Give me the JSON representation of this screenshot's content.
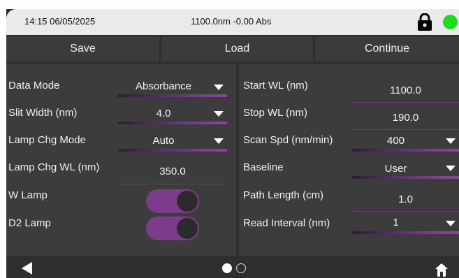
{
  "status": {
    "time": "14:15 06/05/2025",
    "reading": "1100.0nm -0.00 Abs",
    "lock_icon": "lock-icon",
    "indicator_color": "#19e019"
  },
  "toolbar": {
    "save": "Save",
    "load": "Load",
    "continue": "Continue"
  },
  "left": {
    "data_mode": {
      "label": "Data Mode",
      "value": "Absorbance"
    },
    "slit_width": {
      "label": "Slit Width (nm)",
      "value": "4.0"
    },
    "lamp_chg_mode": {
      "label": "Lamp Chg Mode",
      "value": "Auto"
    },
    "lamp_chg_wl": {
      "label": "Lamp Chg WL (nm)",
      "value": "350.0"
    },
    "w_lamp": {
      "label": "W Lamp",
      "state": "on"
    },
    "d2_lamp": {
      "label": "D2 Lamp",
      "state": "on"
    }
  },
  "right": {
    "start_wl": {
      "label": "Start WL (nm)",
      "value": "1100.0"
    },
    "stop_wl": {
      "label": "Stop WL (nm)",
      "value": "190.0"
    },
    "scan_spd": {
      "label": "Scan Spd (nm/min)",
      "value": "400"
    },
    "baseline": {
      "label": "Baseline",
      "value": "User"
    },
    "path_length": {
      "label": "Path Length (cm)",
      "value": "1.0"
    },
    "read_interval": {
      "label": "Read Interval (nm)",
      "value": "1"
    }
  },
  "nav": {
    "page": 1,
    "pages": 2,
    "back_icon": "back-arrow-icon",
    "home_icon": "home-icon"
  },
  "colors": {
    "accent": "#7d3b8c",
    "panel": "#3c3c3c",
    "background": "#2f2f2f"
  }
}
